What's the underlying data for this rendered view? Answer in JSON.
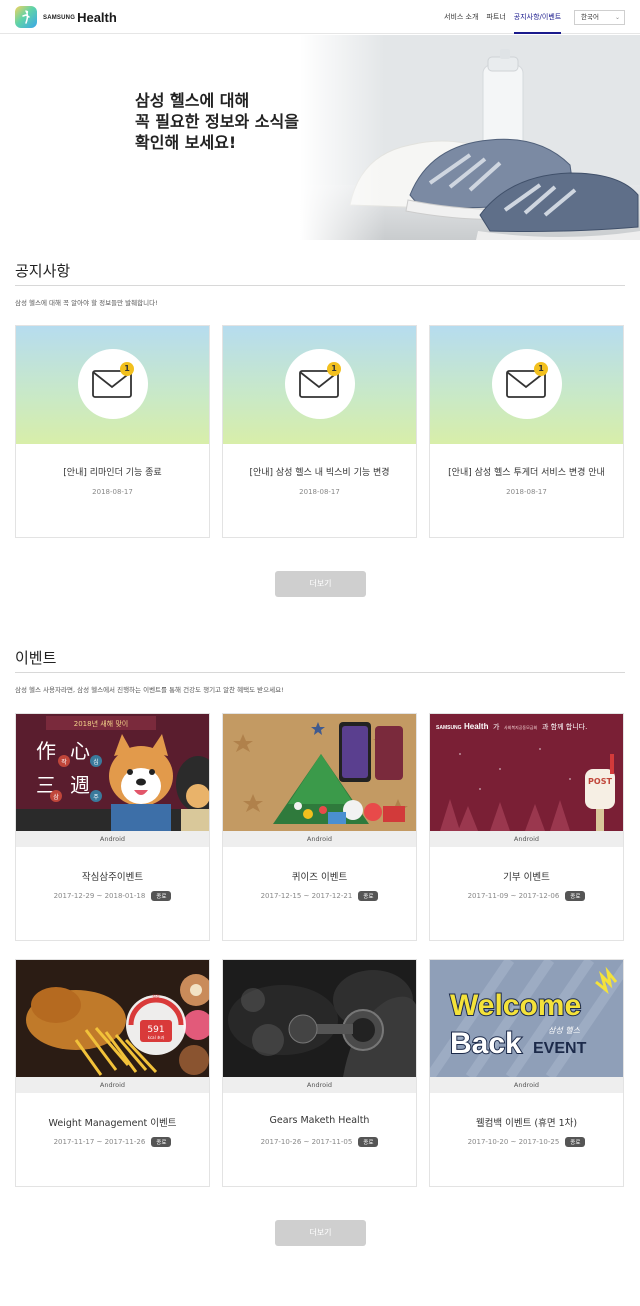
{
  "header": {
    "logo_samsung": "SAMSUNG",
    "logo_health": "Health",
    "nav": [
      "서비스 소개",
      "파트너",
      "공지사항/이벤트"
    ],
    "language": "한국어"
  },
  "hero": {
    "line1": "삼성 헬스에 대해",
    "line2": "꼭 필요한 정보와 소식을",
    "line3": "확인해 보세요!"
  },
  "notices": {
    "title": "공지사항",
    "description": "삼성 헬스에 대해 꼭 알아야 할 정보들만 발췌합니다!",
    "badge_count": "1",
    "items": [
      {
        "title": "[안내] 리마인더 기능 종료",
        "date": "2018-08-17"
      },
      {
        "title": "[안내] 삼성 헬스 내 빅스비 기능 변경",
        "date": "2018-08-17"
      },
      {
        "title": "[안내] 삼성 헬스 투게더 서비스 변경 안내",
        "date": "2018-08-17"
      }
    ],
    "more_label": "더보기"
  },
  "events": {
    "title": "이벤트",
    "description": "삼성 헬스 사용자라면, 삼성 헬스에서 진행하는 이벤트를 통해 건강도 챙기고 알찬 혜택도 받으세요!",
    "status_label": "종료",
    "items": [
      {
        "title": "작심삼주이벤트",
        "period": "2017-12-29 ~ 2018-01-18",
        "platform": "Android",
        "image_text": {
          "top": "2018년 새해 맞이",
          "c1": "作",
          "c2": "心",
          "c3": "三",
          "c4": "週",
          "s1": "작",
          "s2": "심",
          "s3": "삼",
          "s4": "주"
        }
      },
      {
        "title": "퀴이즈 이벤트",
        "period": "2017-12-15 ~ 2017-12-21",
        "platform": "Android",
        "image_text": {}
      },
      {
        "title": "기부 이벤트",
        "period": "2017-11-09 ~ 2017-12-06",
        "platform": "Android",
        "image_text": {
          "banner_pre": "SAMSUNG",
          "banner_health": "Health",
          "banner_mid": "가",
          "banner_org": "사회복지공동모금회",
          "banner_post": "과 함께 합니다.",
          "post": "POST"
        }
      },
      {
        "title": "Weight Management 이벤트",
        "period": "2017-11-17 ~ 2017-11-26",
        "platform": "Android",
        "image_text": {
          "gauge_label": "적정",
          "kcal": "591",
          "kcal_unit": "kcal 초과"
        }
      },
      {
        "title": "Gears Maketh Health",
        "period": "2017-10-26 ~ 2017-11-05",
        "platform": "Android",
        "image_text": {}
      },
      {
        "title": "웰컴백 이벤트 (휴면 1차)",
        "period": "2017-10-20 ~ 2017-10-25",
        "platform": "Android",
        "image_text": {
          "welcome": "Welcome",
          "back": "Back",
          "event": "EVENT",
          "script": "삼성 헬스"
        }
      }
    ],
    "more_label": "더보기"
  },
  "colors": {
    "accent_nav": "#1a1a8c",
    "badge_yellow": "#f2c01e",
    "button_gray": "#cfcfcf",
    "end_badge": "#555555"
  }
}
